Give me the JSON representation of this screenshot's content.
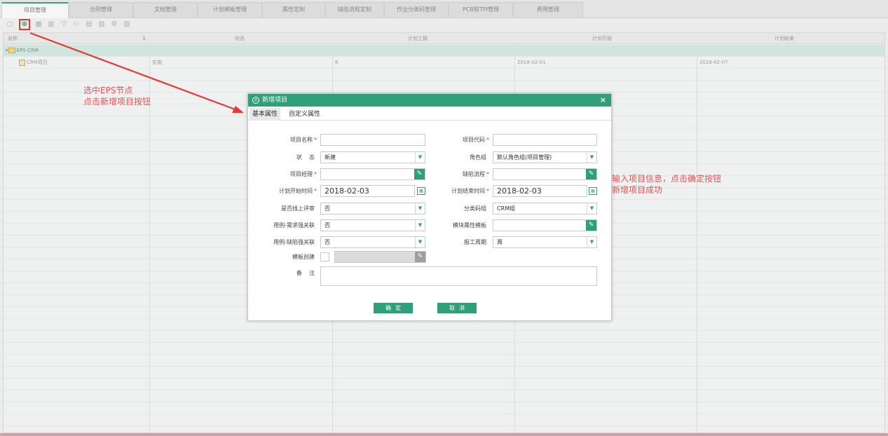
{
  "tabs": [
    "项目管理",
    "合同管理",
    "文档管理",
    "计划模板管理",
    "属性定制",
    "缺陷流程定制",
    "作业分类码管理",
    "PCB和TPI管理",
    "费用管理"
  ],
  "toolbar": {
    "icons": [
      "refresh-icon",
      "add-project-icon",
      "save-icon",
      "delete-icon",
      "filter-icon",
      "users-icon",
      "export-icon",
      "import-icon",
      "settings-icon",
      "report-icon"
    ]
  },
  "grid": {
    "headers": [
      "名称",
      "状态",
      "计划工期",
      "计划开始",
      "计划结束"
    ],
    "eps_row": {
      "name": "EPS-CRM"
    },
    "project_row": {
      "name": "CRM项目",
      "status": "实施",
      "duration": "6",
      "start": "2018-02-01",
      "end": "2018-02-07"
    }
  },
  "annotations": {
    "left_line1": "选中EPS节点",
    "left_line2": "点击新增项目按钮",
    "right_line1": "输入项目信息，点击确定按钮",
    "right_line2": "新增项目成功"
  },
  "dialog": {
    "title": "新增项目",
    "close": "×",
    "tabs": [
      "基本属性",
      "自定义属性"
    ],
    "fields": {
      "project_name_label": "项目名称",
      "project_code_label": "项目代码",
      "status_label": "状    态",
      "status_value": "新建",
      "role_group_label": "角色组",
      "role_group_value": "默认角色组(项目管理)",
      "manager_label": "项目经理",
      "defect_flow_label": "缺陷流程",
      "plan_start_label": "计划开始时间",
      "plan_start_value": "2018-02-03",
      "plan_end_label": "计划结束时间",
      "plan_end_value": "2018-02-03",
      "online_review_label": "是否线上评审",
      "online_review_value": "否",
      "category_label": "分类码组",
      "category_value": "CRM组",
      "req_link_label": "用例-需求强关联",
      "req_link_value": "否",
      "module_tpl_label": "模块属性模板",
      "defect_link_label": "用例-缺陷强关联",
      "defect_link_value": "否",
      "report_period_label": "报工周期",
      "report_period_value": "周",
      "template_create_label": "模板创建",
      "remark_label": "备    注"
    },
    "ok_label": "确定",
    "cancel_label": "取消"
  },
  "colors": {
    "accent": "#2e9f78",
    "annotation": "#f05050",
    "required": "#e53935"
  }
}
